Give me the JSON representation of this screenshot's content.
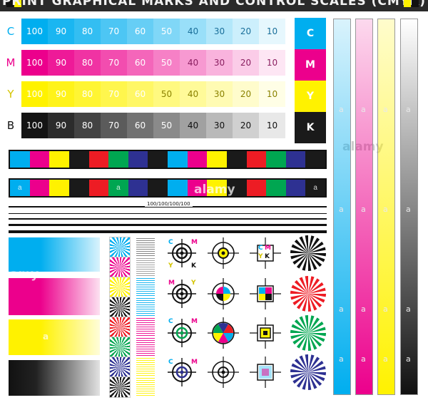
{
  "header": {
    "title": "PRINT GRAPHICAL MARKS AND CONTROL SCALES (CMYK)"
  },
  "colors": {
    "cyan": "#00aeef",
    "magenta": "#ec008c",
    "yellow": "#fff200",
    "black": "#1a1a1a",
    "red": "#ed1c24",
    "green": "#00a651",
    "blue": "#2e3192"
  },
  "tint_scales": {
    "rows": [
      {
        "label": "C",
        "values": [
          "100",
          "90",
          "80",
          "70",
          "60",
          "50",
          "40",
          "30",
          "20",
          "10"
        ],
        "solid_label": "C"
      },
      {
        "label": "M",
        "values": [
          "100",
          "90",
          "80",
          "70",
          "60",
          "50",
          "40",
          "30",
          "20",
          "10"
        ],
        "solid_label": "M"
      },
      {
        "label": "Y",
        "values": [
          "100",
          "90",
          "80",
          "70",
          "60",
          "50",
          "40",
          "30",
          "20",
          "10"
        ],
        "solid_label": "Y"
      },
      {
        "label": "B",
        "values": [
          "100",
          "90",
          "80",
          "70",
          "60",
          "50",
          "40",
          "30",
          "20",
          "10"
        ],
        "solid_label": "K"
      }
    ]
  },
  "color_bar": {
    "patch_mark": "a",
    "watermark": "alamy"
  },
  "line_scale": {
    "label": "100/100/100/100"
  },
  "registration": {
    "c_label": "C",
    "m_label": "M",
    "y_label": "Y",
    "k_label": "K"
  },
  "vertical_bars": {
    "mark": "a"
  },
  "watermarks": {
    "a": "a",
    "alamy": "alamy",
    "amy": "amy"
  }
}
